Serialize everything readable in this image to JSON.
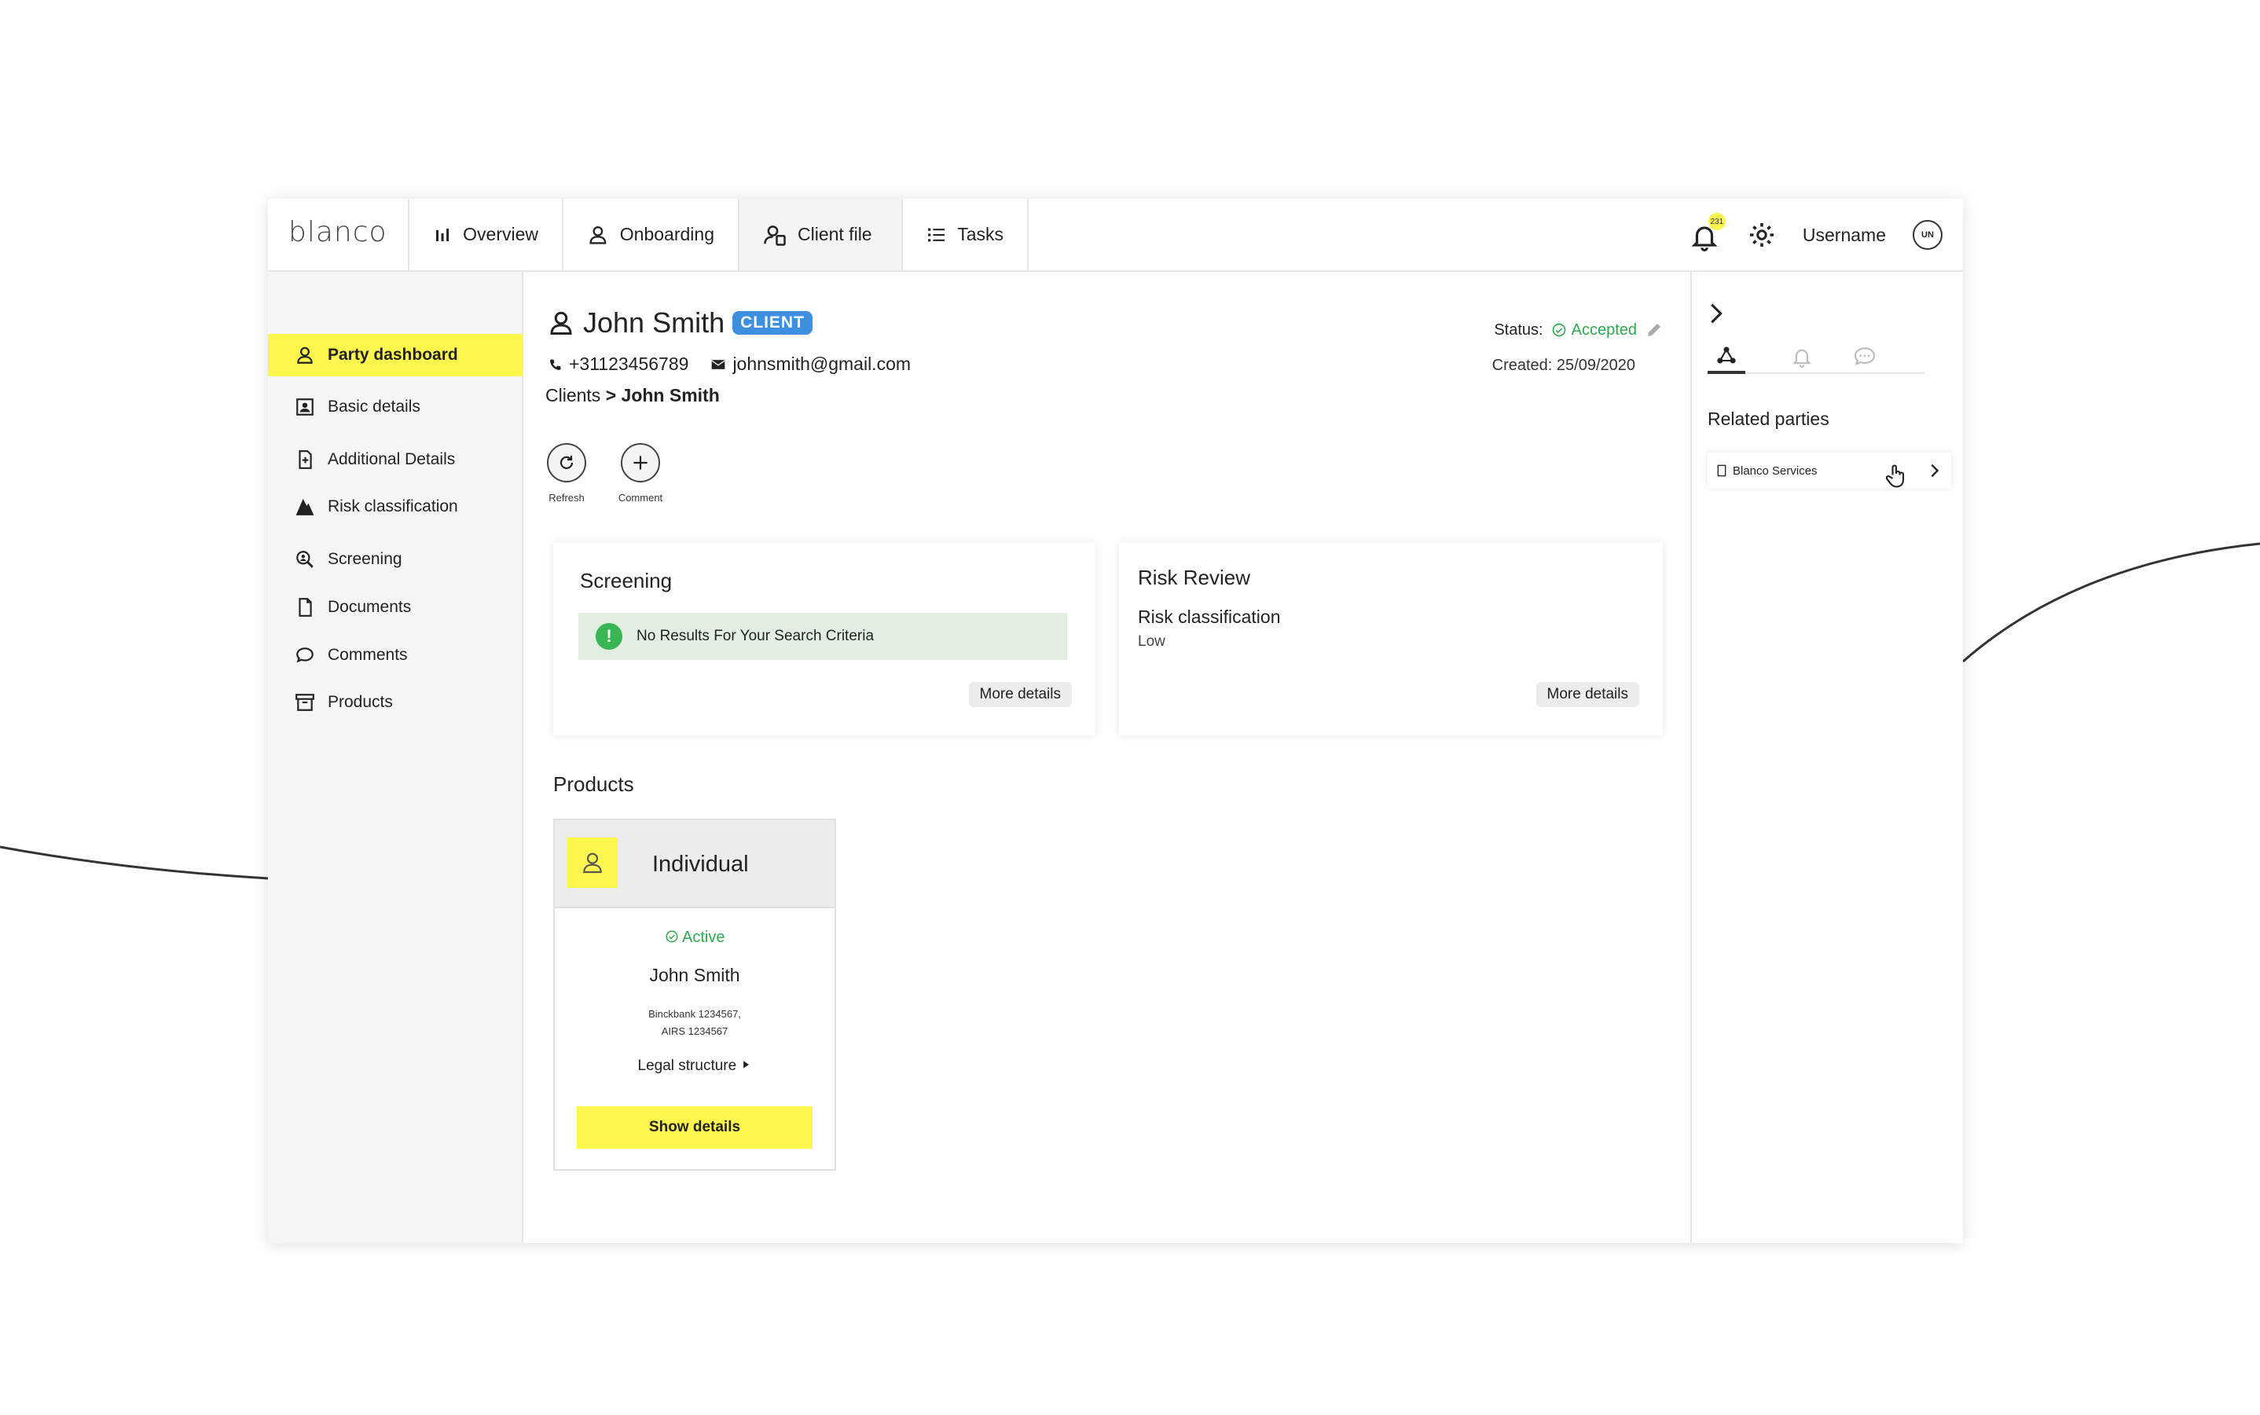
{
  "brand": {
    "logo_text": "blanco",
    "accent": "#fdf64c",
    "badge_blue": "#3d8fe0",
    "success_green": "#2fa84f"
  },
  "nav": {
    "tabs": [
      {
        "label": "Overview",
        "icon": "bar-chart-icon"
      },
      {
        "label": "Onboarding",
        "icon": "person-icon"
      },
      {
        "label": "Client file",
        "icon": "person-file-icon"
      },
      {
        "label": "Tasks",
        "icon": "list-icon"
      }
    ],
    "notification_count": "231",
    "username": "Username",
    "avatar_initials": "UN"
  },
  "sidebar": {
    "items": [
      {
        "label": "Party dashboard",
        "icon": "person-icon",
        "active": true
      },
      {
        "label": "Basic details",
        "icon": "id-card-icon"
      },
      {
        "label": "Additional Details",
        "icon": "document-plus-icon"
      },
      {
        "label": "Risk classification",
        "icon": "mountain-icon"
      },
      {
        "label": "Screening",
        "icon": "search-person-icon"
      },
      {
        "label": "Documents",
        "icon": "document-icon"
      },
      {
        "label": "Comments",
        "icon": "comment-icon"
      },
      {
        "label": "Products",
        "icon": "archive-icon"
      }
    ]
  },
  "party": {
    "name": "John Smith",
    "badge": "CLIENT",
    "phone": "+31123456789",
    "email": "johnsmith@gmail.com",
    "breadcrumb_root": "Clients",
    "breadcrumb_sep": ">",
    "breadcrumb_current": "John Smith",
    "status_label": "Status:",
    "status_value": "Accepted",
    "created": "Created: 25/09/2020"
  },
  "actions": {
    "refresh": "Refresh",
    "comment": "Comment"
  },
  "screening": {
    "title": "Screening",
    "alert": "No Results For Your Search Criteria",
    "more": "More details"
  },
  "risk_review": {
    "title": "Risk Review",
    "subtitle": "Risk classification",
    "value": "Low",
    "more": "More details"
  },
  "products": {
    "title": "Products",
    "card": {
      "type": "Individual",
      "status": "Active",
      "name": "John Smith",
      "account_line1": "Binckbank 1234567,",
      "account_line2": "AIRS 1234567",
      "legal": "Legal structure",
      "button": "Show details"
    }
  },
  "right_panel": {
    "title": "Related parties",
    "items": [
      {
        "label": "Blanco Services"
      }
    ]
  }
}
